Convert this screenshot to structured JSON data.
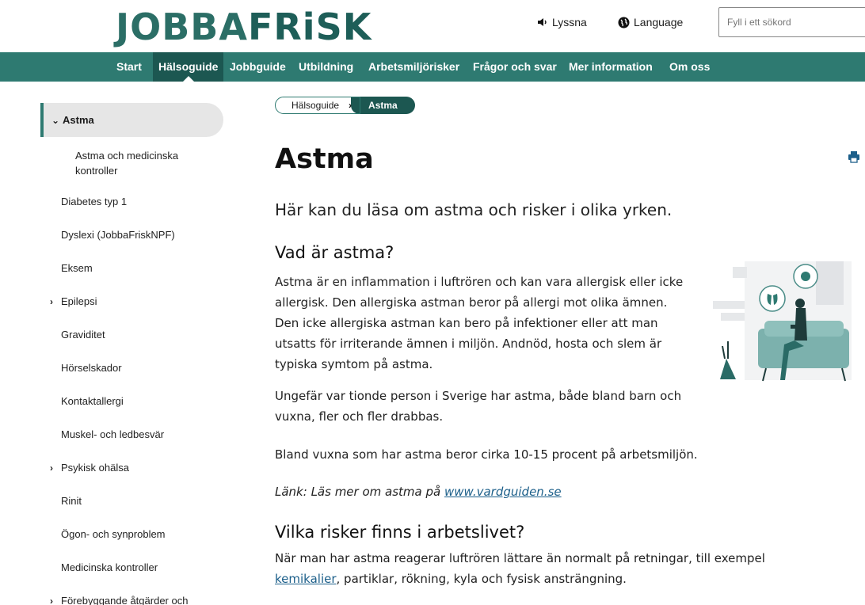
{
  "header": {
    "logo_part1": "JOBBA",
    "logo_part2": "FRiSK",
    "listen_label": "Lyssna",
    "language_label": "Language",
    "search_placeholder": "Fyll i ett sökord"
  },
  "nav": {
    "items": [
      "Start",
      "Hälsoguide",
      "Jobbguide",
      "Utbildning",
      "Arbetsmiljörisker",
      "Frågor och svar",
      "Mer information",
      "Om oss"
    ],
    "active": "Hälsoguide"
  },
  "sidebar": {
    "active_label": "Astma",
    "sub_item": "Astma och medicinska kontroller",
    "items": [
      "Diabetes typ 1",
      "Dyslexi (JobbaFriskNPF)",
      "Eksem",
      "Epilepsi",
      "Graviditet",
      "Hörselskador",
      "Kontaktallergi",
      "Muskel- och ledbesvär",
      "Psykisk ohälsa",
      "Rinit",
      "Ögon- och synproblem",
      "Medicinska kontroller",
      "Förebyggande åtgärder och"
    ]
  },
  "breadcrumb": {
    "parent": "Hälsoguide",
    "current": "Astma"
  },
  "main": {
    "title": "Astma",
    "intro": "Här kan du läsa om astma och risker i olika yrken.",
    "h2_what": "Vad är astma?",
    "para1": "Astma är en inflammation i luftrören och kan vara allergisk eller icke allergisk. Den allergiska astman beror på allergi mot olika ämnen. Den icke allergiska astman kan bero på infektioner eller att man utsatts för irriterande ämnen i miljön.  Andnöd, hosta och slem är typiska symtom på astma.",
    "para2": "Ungefär var tionde person i Sverige har astma, både bland barn och vuxna, fler och fler drabbas.",
    "para3": "Bland vuxna som har astma beror cirka 10-15 procent på arbetsmiljön.",
    "link_prefix": "Länk: Läs mer om astma på ",
    "link_text": "www.vardguiden.se",
    "h2_risks": "Vilka risker finns i arbetslivet?",
    "para5_a": "När man har astma reagerar luftrören lättare än normalt på retningar, till exempel ",
    "para5_link": "kemikalier",
    "para5_b": ", partiklar, rökning, kyla och fysisk ansträngning."
  }
}
